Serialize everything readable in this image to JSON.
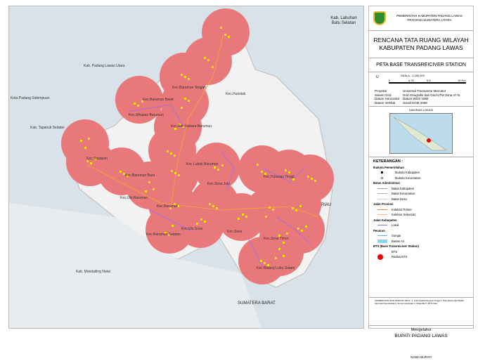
{
  "map": {
    "labels": {
      "labuhan_batu_selatan": "Kab. Labuhan Batu Selatan",
      "padang_lawas_utara": "Kab. Padang Lawas Utara",
      "kota_padang_sidempuan": "Kota Padang Sidempuan",
      "tapanuli_selatan": "Kab. Tapanuli Selatan",
      "mandailing_natal": "Kab. Mandailing Natal",
      "riau": "RIAU",
      "sumatera_barat": "SUMATERA BARAT",
      "barumun_tengah": "Kec.Barumun Tengah",
      "huristak": "Kec.Huristak",
      "barumun_barat": "Kec.Barumun Barat",
      "sihapas_barumun": "Kec.Sihapas Barumun",
      "aek_nabara": "Kec.Aek Nabara Barumun",
      "lubuk_barumun": "Kec.Lubuk Barumun",
      "sosopan": "Kec.Sosopan",
      "barumun_baru": "Kec.Barumun Baru",
      "sosa_julu": "Kec.Sosa Julu",
      "hutaraja_tinggi": "Kec.Hutaraja Tinggi",
      "ulu_barumun": "Kec.Ulu Barumun",
      "barumun": "Kec.Barumun",
      "ulu_sosa": "Kec.Ulu Sosa",
      "barumun_selatan": "Kec.Barumun Selatan",
      "sosa": "Kec.Sosa",
      "sosa_timur": "Kec.Sosa Timur",
      "batang_lubu_sutam": "Kec.Batang Lubu Sutam"
    }
  },
  "panel": {
    "gov_line1": "PEMERINTAH KABUPATEN PADANG LAWAS",
    "gov_line2": "PROVINSI SUMATERA UTARA",
    "title_line1": "RENCANA TATA RUANG WILAYAH",
    "title_line2": "KABUPATEN PADANG LAWAS",
    "subtitle": "PETA BASE TRANSREICIVER STATION",
    "north": "U",
    "scale": "SKALA : 1:180.000",
    "scale_ticks": [
      "0",
      "4,75",
      "9,5",
      "19 Km"
    ],
    "projection": [
      {
        "k": "Proyeksi",
        "v": "Universal Transverse Mercator"
      },
      {
        "k": "Sistem Grid",
        "v": "Grid Geografis dan Grid UTM Zona 47 N"
      },
      {
        "k": "Datum Horizontal",
        "v": "Datum WGS 1984"
      },
      {
        "k": "Datum Vertikal",
        "v": "Geoid EGM 2008"
      }
    ],
    "diagram_title": "DIAGRAM LOKASI",
    "legend": {
      "title": "KETERANGAN :",
      "g1": "Ibukota Pemerintahan",
      "i1": "Ibukota Kabupaten",
      "i2": "Ibukota Kecamatan",
      "g2": "Batas Administrasi",
      "i3": "Batas Kabupaten",
      "i4": "Batas Kecamatan",
      "i5": "Batas Desa",
      "g3": "Jalan Provinsi",
      "i6": "Kolektor Primer",
      "i7": "Kolektor Sekunder",
      "g4": "Jalan Kabupaten",
      "i8": "Lokal",
      "g5": "Perairan",
      "i9": "Sungai",
      "i10": "Badan Air",
      "g6": "BTS (Base Transreiciver Station)",
      "i11": "BTS",
      "i12": "Radius BTS"
    },
    "notes": "SUMBER DATA DAN RIWAYAT PETA : 1. Citra Satelit Resolusi Tinggi 2. Peta Dasar dari Badan Informasi Geospasial 3. Survei Lapangan 4. Shapefile 5. BTS Data",
    "approve": "Mengetahui",
    "official": "BUPATI PADANG LAWAS",
    "name": "NAMA BUPATI"
  },
  "colors": {
    "bts_radius": "#e8787a",
    "bts": "#ffe600",
    "road_local": "#9a6cf0",
    "road_primary": "#f0a040"
  }
}
